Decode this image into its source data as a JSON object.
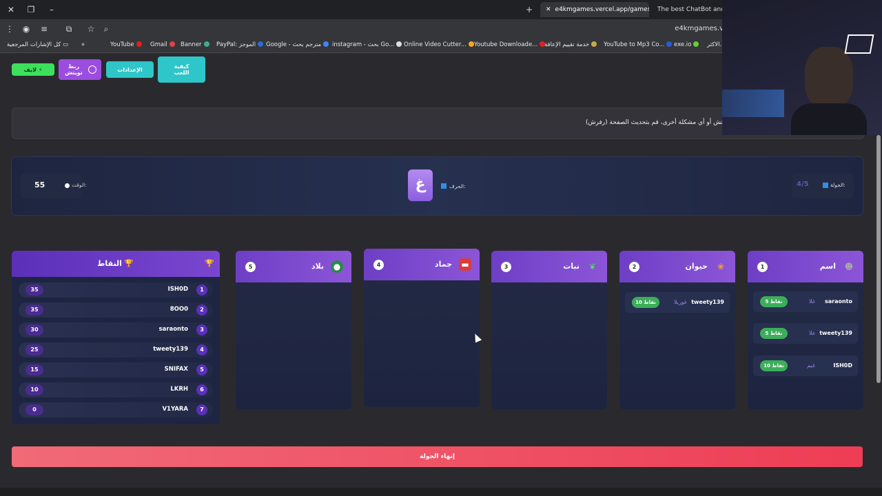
{
  "browser": {
    "tabs": [
      "e4kmgames.vercel.app/games/",
      "The best ChatBot and Wi"
    ],
    "url": "e4kmgames.v",
    "bookmarks": [
      "كل الإشارات المرجعية",
      "YouTube",
      "Gmail",
      "Banner",
      "PayPal: الموجز",
      "Google - مترجم بحث",
      "instagram - بحث Go...",
      "Online Video Cutter...",
      "Youtube Downloade...",
      "خدمة تقييم الإعاقة",
      "YouTube to Mp3 Co...",
      "exe.io",
      "الاكثر..."
    ]
  },
  "toolbar": {
    "howto": "كيفية اللعب",
    "settings": "الإعدادات",
    "twitch_link": "ربط تويتش",
    "green": "لايف"
  },
  "notice": "تويتش أو أي مشكلة أخرى، قم بتحديث الصفحة (رفرش).",
  "game": {
    "round_label": "الجولة:",
    "round_value": "4/5",
    "letter_label": "الحرف:",
    "letter": "غ",
    "time_label": "الوقت:",
    "time_value": "55"
  },
  "categories": [
    {
      "title": "اسم",
      "num": "1",
      "icon": "person-icon",
      "answers": [
        {
          "player": "saraonto",
          "word": "غلا",
          "pts": "5 نقاط"
        },
        {
          "player": "tweety139",
          "word": "غلا",
          "pts": "5 نقاط"
        },
        {
          "player": "ISH0D",
          "word": "غيم",
          "pts": "10 نقاط"
        }
      ]
    },
    {
      "title": "حيوان",
      "num": "2",
      "icon": "paw-icon",
      "answers": [
        {
          "player": "tweety139",
          "word": "غوريلا",
          "pts": "10 نقاط"
        }
      ]
    },
    {
      "title": "نبات",
      "num": "3",
      "icon": "leaf-icon",
      "answers": []
    },
    {
      "title": "جماد",
      "num": "4",
      "icon": "toolbox-icon",
      "answers": []
    },
    {
      "title": "بلاد",
      "num": "5",
      "icon": "globe-icon",
      "answers": []
    }
  ],
  "scores": {
    "title": "النقاط",
    "rows": [
      {
        "rank": "1",
        "name": "ISH0D",
        "pts": "35"
      },
      {
        "rank": "2",
        "name": "8OO0",
        "pts": "35"
      },
      {
        "rank": "3",
        "name": "saraonto",
        "pts": "30"
      },
      {
        "rank": "4",
        "name": "tweety139",
        "pts": "25"
      },
      {
        "rank": "5",
        "name": "SNIFAX",
        "pts": "15"
      },
      {
        "rank": "6",
        "name": "LKRH",
        "pts": "10"
      },
      {
        "rank": "7",
        "name": "V1YARA",
        "pts": "0"
      }
    ]
  },
  "end_round": "إنهاء الجولة"
}
